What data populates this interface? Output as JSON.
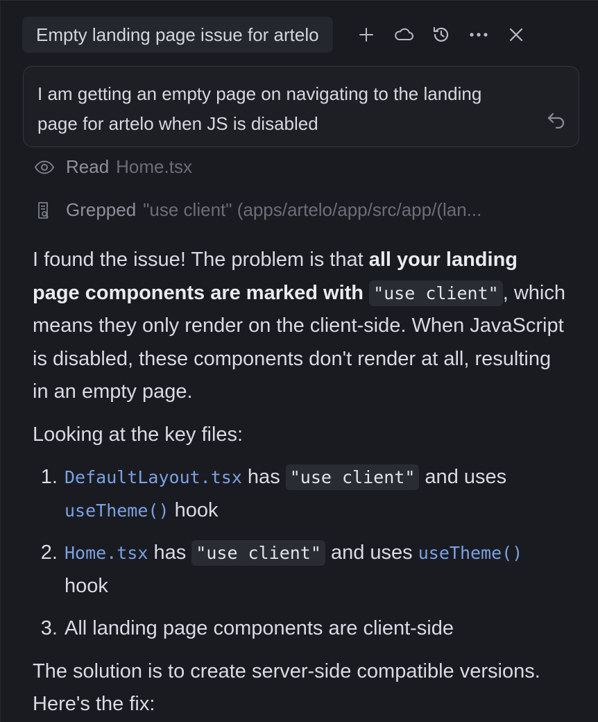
{
  "header": {
    "tab_title": "Empty landing page issue for artelo",
    "actions": [
      {
        "icon": "plus-icon",
        "name": "new-chat-button"
      },
      {
        "icon": "cloud-icon",
        "name": "cloud-button"
      },
      {
        "icon": "history-icon",
        "name": "history-button"
      },
      {
        "icon": "more-icon",
        "name": "more-button"
      },
      {
        "icon": "close-icon",
        "name": "close-button"
      }
    ]
  },
  "query": {
    "text": "I am getting an empty page on navigating to the landing page for artelo when JS is disabled"
  },
  "tools": [
    {
      "icon": "eye-icon",
      "verb": "Read",
      "arg": "Home.tsx"
    },
    {
      "icon": "grep-icon",
      "verb": "Grepped",
      "arg": "\"use client\" (apps/artelo/app/src/app/(lan..."
    }
  ],
  "response": {
    "p1_a": "I found the issue! The problem is that ",
    "p1_bold": "all your landing page components are marked with ",
    "p1_code": "\"use client\"",
    "p1_b": ", which means they only render on the client-side. When JavaScript is disabled, these components don't render at all, resulting in an empty page.",
    "p2": "Looking at the key files:",
    "items": [
      {
        "file": "DefaultLayout.tsx",
        "t1": " has ",
        "code": "\"use client\"",
        "t2": " and uses ",
        "hook": "useTheme()",
        "t3": " hook"
      },
      {
        "file": "Home.tsx",
        "t1": " has ",
        "code": "\"use client\"",
        "t2": " and uses ",
        "hook": "useTheme()",
        "t3": " hook"
      }
    ],
    "item3": "All landing page components are client-side",
    "p3": "The solution is to create server-side compatible versions. Here's the fix:"
  },
  "colors": {
    "background": "#1a1b21",
    "tab_bg": "#25272e",
    "code_bg": "#2a2c33",
    "link_code": "#7aa2e3"
  }
}
